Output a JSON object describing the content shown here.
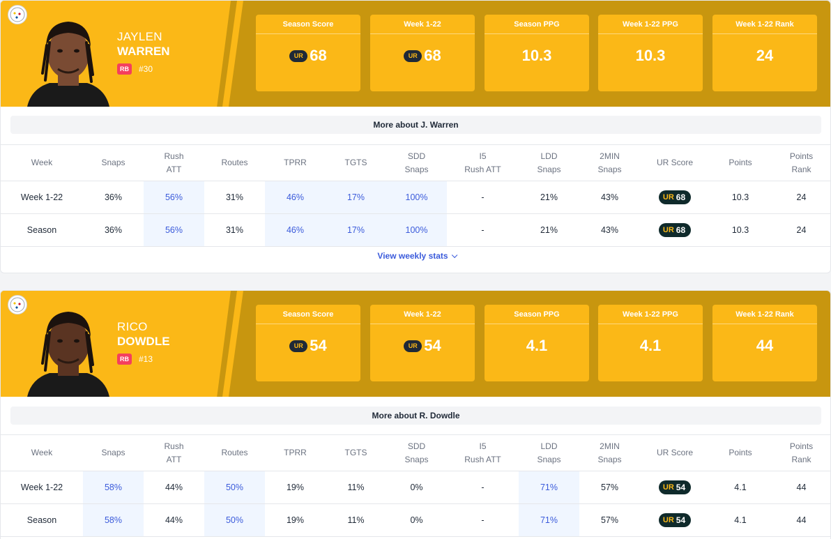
{
  "players": [
    {
      "first_name": "JAYLEN",
      "last_name": "WARREN",
      "position": "RB",
      "number": "#30",
      "stats": [
        {
          "label": "Season Score",
          "value": "68",
          "badge": true
        },
        {
          "label": "Week 1-22",
          "value": "68",
          "badge": true
        },
        {
          "label": "Season PPG",
          "value": "10.3",
          "badge": false
        },
        {
          "label": "Week 1-22 PPG",
          "value": "10.3",
          "badge": false
        },
        {
          "label": "Week 1-22 Rank",
          "value": "24",
          "badge": false
        }
      ],
      "more_label": "More about J. Warren",
      "rows": [
        [
          "Week 1-22",
          "36%",
          "56%",
          "31%",
          "46%",
          "17%",
          "100%",
          "-",
          "21%",
          "43%",
          "68",
          "10.3",
          "24"
        ],
        [
          "Season",
          "36%",
          "56%",
          "31%",
          "46%",
          "17%",
          "100%",
          "-",
          "21%",
          "43%",
          "68",
          "10.3",
          "24"
        ]
      ],
      "highlight_cols": [
        2,
        4,
        5,
        6
      ],
      "view_more": "View weekly stats"
    },
    {
      "first_name": "RICO",
      "last_name": "DOWDLE",
      "position": "RB",
      "number": "#13",
      "stats": [
        {
          "label": "Season Score",
          "value": "54",
          "badge": true
        },
        {
          "label": "Week 1-22",
          "value": "54",
          "badge": true
        },
        {
          "label": "Season PPG",
          "value": "4.1",
          "badge": false
        },
        {
          "label": "Week 1-22 PPG",
          "value": "4.1",
          "badge": false
        },
        {
          "label": "Week 1-22 Rank",
          "value": "44",
          "badge": false
        }
      ],
      "more_label": "More about R. Dowdle",
      "rows": [
        [
          "Week 1-22",
          "58%",
          "44%",
          "50%",
          "19%",
          "11%",
          "0%",
          "-",
          "71%",
          "57%",
          "54",
          "4.1",
          "44"
        ],
        [
          "Season",
          "58%",
          "44%",
          "50%",
          "19%",
          "11%",
          "0%",
          "-",
          "71%",
          "57%",
          "54",
          "4.1",
          "44"
        ]
      ],
      "highlight_cols": [
        1,
        3,
        8
      ],
      "view_more": ""
    }
  ],
  "table_headers": [
    [
      "Week"
    ],
    [
      "Snaps"
    ],
    [
      "Rush",
      "ATT"
    ],
    [
      "Routes"
    ],
    [
      "TPRR"
    ],
    [
      "TGTS"
    ],
    [
      "SDD",
      "Snaps"
    ],
    [
      "I5",
      "Rush ATT"
    ],
    [
      "LDD",
      "Snaps"
    ],
    [
      "2MIN",
      "Snaps"
    ],
    [
      "UR Score"
    ],
    [
      "Points"
    ],
    [
      "Points",
      "Rank"
    ]
  ],
  "ur_badge_text": "UR",
  "colors": {
    "team_gold": "#fbb817",
    "team_dark_gold": "#c8960f",
    "accent_blue": "#3b5bdb",
    "score_badge": "#0f2a2b",
    "position_badge": "#f43f5e"
  }
}
